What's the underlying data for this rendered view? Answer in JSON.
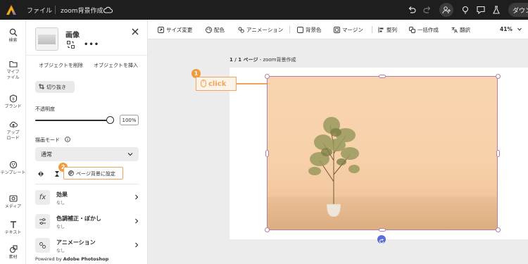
{
  "topbar": {
    "menu_file": "ファイル",
    "doc_title": "zoom背景作成",
    "download_label": "ダウンロード",
    "icons": [
      "adobe-express-logo",
      "cloud-icon",
      "undo-icon",
      "redo-icon",
      "add-user-icon",
      "lightbulb-icon",
      "comment-icon",
      "lab-flask-icon"
    ]
  },
  "rail": {
    "items": [
      {
        "label": "検索",
        "icon": "search-icon"
      },
      {
        "label": "マイファイル",
        "icon": "folder-icon"
      },
      {
        "label": "ブランド",
        "icon": "brand-icon"
      },
      {
        "label": "アップロード",
        "icon": "upload-icon"
      },
      {
        "label": "テンプレート",
        "icon": "template-icon"
      },
      {
        "label": "メディア",
        "icon": "media-icon"
      },
      {
        "label": "テキスト",
        "icon": "text-icon"
      },
      {
        "label": "素材",
        "icon": "elements-icon"
      }
    ]
  },
  "panel": {
    "title": "画像",
    "object_delete": "オブジェクトを削除",
    "object_insert": "オブジェクトを挿入",
    "crop_label": "切り抜き",
    "opacity_label": "不透明度",
    "opacity_value": "100%",
    "opacity_level": 1.0,
    "blend_mode_label": "描画モード",
    "blend_mode_value": "通常",
    "set_bg_label": "ページ背景に設定",
    "step_2": "2",
    "accordions": [
      {
        "title": "効果",
        "sub": "なし",
        "icon": "fx-icon",
        "icon_text": "fx"
      },
      {
        "title": "色調補正・ぼかし",
        "sub": "なし",
        "icon": "adjust-icon"
      },
      {
        "title": "アニメーション",
        "sub": "なし",
        "icon": "animation-icon"
      }
    ],
    "powered_prefix": "Powered by ",
    "powered_brand": "Adobe Photoshop"
  },
  "context_bar": {
    "items": [
      "サイズ変更",
      "配色",
      "アニメーション",
      "背景色",
      "マージン",
      "整列",
      "一括作成",
      "翻訳"
    ],
    "zoom": "41%"
  },
  "canvas": {
    "page_label_bold": "1 / 1 ページ",
    "page_label_rest": " - zoom背景作成",
    "step_1": "1",
    "click_label": "click"
  },
  "colors": {
    "topbar_bg": "#1e1e1e",
    "annotation_orange": "#f29a3a",
    "selection_border": "#b57fa6",
    "rotate_handle": "#5b6fd6",
    "photo_bg": "#f7d0a9"
  }
}
